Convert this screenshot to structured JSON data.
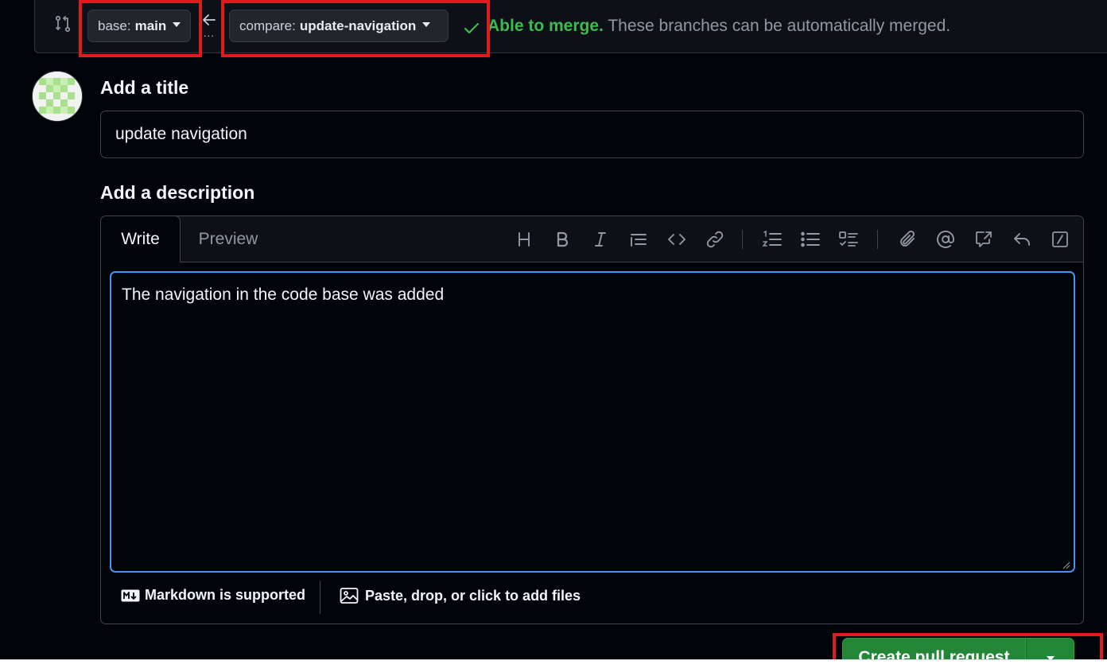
{
  "colors": {
    "background": "#010409",
    "success": "#3fb950",
    "primary_button": "#238636",
    "focus_border": "#4493f8",
    "annotation": "#e11b1b"
  },
  "compare_bar": {
    "icon": "git-compare-icon",
    "base": {
      "prefix": "base:",
      "name": "main"
    },
    "arrow_icon": "arrow-left-icon",
    "dots": "...",
    "compare": {
      "prefix": "compare:",
      "name": "update-navigation"
    },
    "merge_icon": "check-icon",
    "merge_status": "Able to merge.",
    "merge_message": "These branches can be automatically merged."
  },
  "title_section": {
    "label": "Add a title",
    "value": "update navigation"
  },
  "description_section": {
    "label": "Add a description",
    "tabs": [
      "Write",
      "Preview"
    ],
    "toolbar": [
      "heading-icon",
      "bold-icon",
      "italic-icon",
      "quote-icon",
      "code-icon",
      "link-icon",
      "ordered-list-icon",
      "unordered-list-icon",
      "task-list-icon",
      "attach-icon",
      "mention-icon",
      "reference-icon",
      "reply-icon",
      "slash-command-icon"
    ],
    "body": "The navigation in the code base was added",
    "markdown_note": "Markdown is supported",
    "attach_note": "Paste, drop, or click to add files"
  },
  "submit": {
    "label": "Create pull request",
    "dropdown_icon": "caret-down-icon"
  }
}
